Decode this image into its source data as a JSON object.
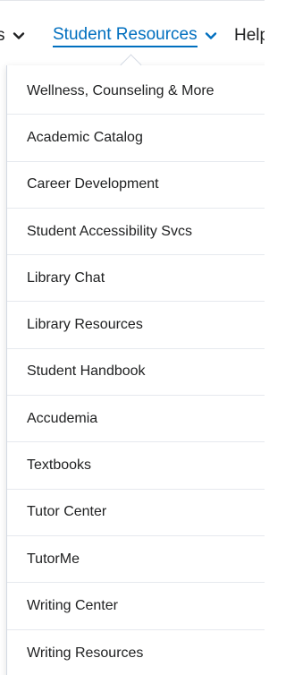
{
  "nav": {
    "prev_label": "s",
    "active_label": "Student Resources",
    "next_label": "Help",
    "active_color": "#006fbf"
  },
  "menu": {
    "items": [
      {
        "label": "Wellness, Counseling & More"
      },
      {
        "label": "Academic Catalog"
      },
      {
        "label": "Career Development"
      },
      {
        "label": "Student Accessibility Svcs"
      },
      {
        "label": "Library Chat"
      },
      {
        "label": "Library Resources"
      },
      {
        "label": "Student Handbook"
      },
      {
        "label": "Accudemia"
      },
      {
        "label": "Textbooks"
      },
      {
        "label": "Tutor Center"
      },
      {
        "label": "TutorMe"
      },
      {
        "label": "Writing Center"
      },
      {
        "label": "Writing Resources"
      }
    ]
  },
  "icons": {
    "chevron": "chevron-down-icon"
  }
}
